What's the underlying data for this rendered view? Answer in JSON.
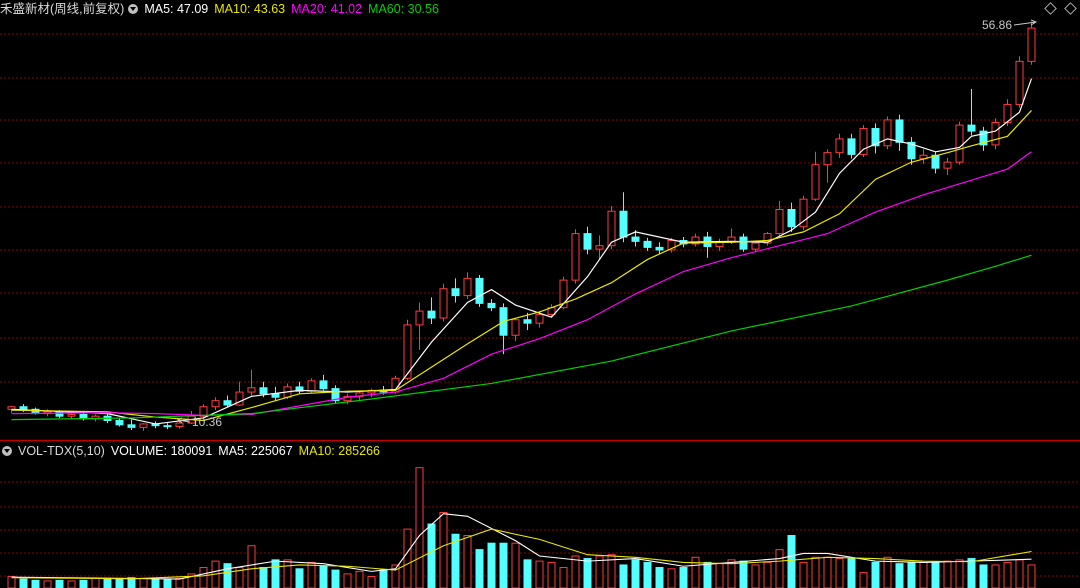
{
  "colors": {
    "up": "#ff3b3b",
    "down": "#54ffff",
    "ma5": "#ffffff",
    "ma10": "#e8e800",
    "ma20": "#ff00ff",
    "ma60": "#00d000",
    "grid": "#8a0000",
    "divider": "#c00000"
  },
  "header": {
    "stock_label": "禾盛新材(周线,前复权)",
    "ma5": "MA5: 47.09",
    "ma10": "MA10: 43.63",
    "ma20": "MA20: 41.02",
    "ma60": "MA60: 30.56"
  },
  "annotations": {
    "high": "56.86",
    "low": "10.36"
  },
  "volume_header": {
    "indicator": "VOL-TDX(5,10)",
    "volume": "VOLUME: 180091",
    "ma5": "MA5: 225067",
    "ma10": "MA10: 285266"
  },
  "chart_data": [
    {
      "type": "candlestick",
      "title": "禾盛新材(周线,前复权)",
      "y_range": [
        9.5,
        58.5
      ],
      "candles": [
        [
          12.6,
          13.0,
          12.2,
          12.9
        ],
        [
          12.9,
          13.2,
          12.3,
          12.6
        ],
        [
          12.6,
          12.8,
          12.0,
          12.1
        ],
        [
          12.1,
          12.6,
          11.8,
          12.3
        ],
        [
          12.3,
          12.5,
          11.6,
          11.8
        ],
        [
          11.8,
          12.3,
          11.5,
          12.0
        ],
        [
          12.0,
          12.4,
          11.3,
          11.5
        ],
        [
          11.5,
          12.0,
          11.2,
          11.8
        ],
        [
          11.8,
          12.1,
          11.0,
          11.3
        ],
        [
          11.3,
          11.6,
          10.6,
          10.8
        ],
        [
          10.8,
          11.4,
          10.2,
          10.5
        ],
        [
          10.5,
          11.0,
          10.1,
          10.9
        ],
        [
          10.9,
          11.2,
          10.4,
          10.7
        ],
        [
          10.7,
          11.0,
          10.3,
          10.6
        ],
        [
          10.6,
          11.3,
          10.36,
          11.0
        ],
        [
          11.0,
          12.4,
          10.9,
          11.8
        ],
        [
          11.8,
          13.2,
          11.6,
          12.9
        ],
        [
          12.9,
          14.0,
          12.5,
          13.6
        ],
        [
          13.6,
          14.2,
          12.9,
          13.1
        ],
        [
          13.1,
          15.8,
          13.0,
          14.6
        ],
        [
          14.6,
          17.2,
          14.2,
          15.1
        ],
        [
          15.1,
          15.8,
          14.0,
          14.4
        ],
        [
          14.4,
          15.2,
          13.6,
          14.0
        ],
        [
          14.0,
          15.6,
          13.8,
          15.2
        ],
        [
          15.2,
          15.8,
          14.4,
          14.7
        ],
        [
          14.7,
          16.2,
          14.5,
          15.9
        ],
        [
          15.9,
          16.6,
          14.8,
          15.0
        ],
        [
          15.0,
          15.4,
          13.3,
          13.6
        ],
        [
          13.6,
          14.4,
          13.2,
          14.1
        ],
        [
          14.1,
          14.8,
          13.7,
          14.5
        ],
        [
          14.5,
          15.0,
          14.0,
          14.8
        ],
        [
          14.8,
          15.3,
          14.3,
          14.6
        ],
        [
          14.6,
          16.5,
          14.4,
          16.2
        ],
        [
          16.2,
          23.0,
          16.0,
          22.4
        ],
        [
          22.4,
          25.0,
          19.5,
          24.0
        ],
        [
          24.0,
          25.6,
          22.5,
          23.2
        ],
        [
          23.2,
          27.2,
          22.8,
          26.6
        ],
        [
          26.6,
          27.8,
          25.0,
          25.8
        ],
        [
          25.8,
          28.5,
          25.4,
          27.8
        ],
        [
          27.8,
          28.2,
          24.5,
          24.9
        ],
        [
          24.9,
          25.4,
          24.0,
          24.4
        ],
        [
          24.4,
          24.9,
          19.0,
          21.2
        ],
        [
          21.2,
          23.2,
          20.5,
          23.0
        ],
        [
          23.0,
          23.8,
          21.8,
          22.6
        ],
        [
          22.6,
          24.0,
          22.1,
          23.6
        ],
        [
          23.6,
          24.8,
          23.4,
          24.4
        ],
        [
          24.4,
          28.0,
          24.2,
          27.6
        ],
        [
          27.6,
          33.5,
          27.2,
          33.0
        ],
        [
          33.0,
          33.8,
          30.6,
          31.2
        ],
        [
          31.2,
          32.8,
          30.0,
          31.6
        ],
        [
          31.6,
          36.2,
          31.2,
          35.6
        ],
        [
          35.6,
          37.8,
          32.0,
          32.6
        ],
        [
          32.6,
          33.4,
          31.5,
          32.1
        ],
        [
          32.1,
          32.5,
          31.0,
          31.4
        ],
        [
          31.4,
          32.0,
          30.6,
          31.1
        ],
        [
          31.1,
          32.5,
          30.8,
          32.2
        ],
        [
          32.2,
          32.6,
          31.4,
          31.8
        ],
        [
          31.8,
          33.0,
          31.5,
          32.6
        ],
        [
          32.6,
          33.2,
          30.2,
          31.5
        ],
        [
          31.5,
          32.4,
          31.0,
          32.0
        ],
        [
          32.0,
          33.6,
          31.8,
          32.6
        ],
        [
          32.6,
          33.0,
          30.9,
          31.2
        ],
        [
          31.2,
          32.2,
          30.9,
          31.9
        ],
        [
          31.9,
          33.2,
          31.6,
          33.0
        ],
        [
          33.0,
          36.8,
          32.7,
          35.8
        ],
        [
          35.8,
          36.6,
          33.2,
          33.8
        ],
        [
          33.8,
          37.4,
          33.4,
          37.0
        ],
        [
          37.0,
          42.5,
          36.8,
          41.0
        ],
        [
          41.0,
          42.8,
          38.9,
          42.4
        ],
        [
          42.4,
          44.6,
          41.8,
          44.0
        ],
        [
          44.0,
          44.6,
          41.7,
          42.2
        ],
        [
          42.2,
          45.6,
          41.9,
          45.2
        ],
        [
          45.2,
          45.8,
          42.3,
          43.2
        ],
        [
          43.2,
          46.6,
          42.8,
          46.2
        ],
        [
          46.2,
          46.8,
          42.6,
          43.6
        ],
        [
          43.6,
          44.2,
          41.0,
          41.7
        ],
        [
          41.7,
          42.8,
          41.1,
          42.1
        ],
        [
          42.1,
          42.5,
          40.0,
          40.6
        ],
        [
          40.6,
          41.8,
          39.8,
          41.3
        ],
        [
          41.3,
          46.0,
          41.0,
          45.6
        ],
        [
          45.6,
          49.8,
          44.4,
          44.9
        ],
        [
          44.9,
          45.4,
          42.6,
          43.3
        ],
        [
          43.3,
          46.4,
          42.8,
          45.9
        ],
        [
          45.9,
          48.6,
          45.5,
          48.0
        ],
        [
          48.0,
          53.6,
          47.6,
          53.0
        ],
        [
          53.0,
          57.6,
          52.6,
          56.86
        ]
      ],
      "moving_averages": {
        "MA5": [
          [
            0,
            12.6
          ],
          [
            8,
            12.1
          ],
          [
            12,
            10.9
          ],
          [
            16,
            11.6
          ],
          [
            20,
            14.1
          ],
          [
            24,
            14.8
          ],
          [
            28,
            14.6
          ],
          [
            32,
            14.9
          ],
          [
            35,
            20.4
          ],
          [
            38,
            25.0
          ],
          [
            40,
            26.5
          ],
          [
            42,
            24.7
          ],
          [
            45,
            23.3
          ],
          [
            48,
            28.0
          ],
          [
            50,
            32.0
          ],
          [
            52,
            33.2
          ],
          [
            56,
            32.0
          ],
          [
            60,
            32.1
          ],
          [
            63,
            32.0
          ],
          [
            65,
            33.4
          ],
          [
            67,
            35.5
          ],
          [
            69,
            40.0
          ],
          [
            71,
            42.8
          ],
          [
            73,
            44.0
          ],
          [
            75,
            43.4
          ],
          [
            77,
            42.5
          ],
          [
            79,
            43.0
          ],
          [
            80,
            44.3
          ],
          [
            82,
            44.9
          ],
          [
            84,
            47.1
          ],
          [
            85,
            51.0
          ]
        ],
        "MA10": [
          [
            0,
            12.5
          ],
          [
            8,
            12.3
          ],
          [
            12,
            11.7
          ],
          [
            16,
            11.3
          ],
          [
            20,
            12.8
          ],
          [
            24,
            14.4
          ],
          [
            28,
            14.7
          ],
          [
            32,
            14.8
          ],
          [
            35,
            17.5
          ],
          [
            38,
            20.2
          ],
          [
            41,
            22.8
          ],
          [
            44,
            23.9
          ],
          [
            47,
            25.4
          ],
          [
            50,
            27.3
          ],
          [
            53,
            30.0
          ],
          [
            56,
            31.9
          ],
          [
            60,
            32.0
          ],
          [
            63,
            32.2
          ],
          [
            66,
            33.2
          ],
          [
            69,
            35.3
          ],
          [
            72,
            39.3
          ],
          [
            75,
            41.3
          ],
          [
            78,
            42.4
          ],
          [
            80,
            43.2
          ],
          [
            83,
            44.3
          ],
          [
            85,
            47.3
          ]
        ],
        "MA20": [
          [
            0,
            12.1
          ],
          [
            8,
            12.2
          ],
          [
            12,
            12.1
          ],
          [
            16,
            11.9
          ],
          [
            20,
            12.0
          ],
          [
            24,
            13.0
          ],
          [
            28,
            14.0
          ],
          [
            32,
            14.6
          ],
          [
            36,
            16.2
          ],
          [
            40,
            19.0
          ],
          [
            44,
            20.8
          ],
          [
            48,
            23.0
          ],
          [
            52,
            26.0
          ],
          [
            56,
            28.6
          ],
          [
            60,
            30.2
          ],
          [
            64,
            31.6
          ],
          [
            68,
            33.0
          ],
          [
            72,
            35.5
          ],
          [
            76,
            37.5
          ],
          [
            80,
            39.2
          ],
          [
            83,
            40.5
          ],
          [
            85,
            42.5
          ]
        ],
        "MA60": [
          [
            0,
            11.4
          ],
          [
            10,
            11.6
          ],
          [
            20,
            12.1
          ],
          [
            30,
            13.8
          ],
          [
            40,
            15.6
          ],
          [
            50,
            18.2
          ],
          [
            60,
            21.7
          ],
          [
            70,
            24.6
          ],
          [
            78,
            27.6
          ],
          [
            82,
            29.2
          ],
          [
            85,
            30.5
          ]
        ]
      }
    },
    {
      "type": "bar",
      "title": "VOL-TDX(5,10)",
      "y_range": [
        0,
        1000000
      ],
      "volumes": [
        90000,
        70000,
        60000,
        55000,
        60000,
        55000,
        60000,
        75000,
        75000,
        75000,
        80000,
        75000,
        70000,
        65000,
        75000,
        110000,
        160000,
        210000,
        190000,
        160000,
        330000,
        160000,
        220000,
        220000,
        150000,
        200000,
        170000,
        140000,
        110000,
        130000,
        90000,
        140000,
        180000,
        460000,
        940000,
        500000,
        590000,
        420000,
        410000,
        300000,
        350000,
        350000,
        350000,
        220000,
        210000,
        200000,
        160000,
        250000,
        230000,
        250000,
        260000,
        180000,
        220000,
        200000,
        160000,
        150000,
        160000,
        240000,
        200000,
        190000,
        220000,
        210000,
        180000,
        200000,
        300000,
        410000,
        200000,
        240000,
        240000,
        230000,
        230000,
        120000,
        200000,
        240000,
        190000,
        200000,
        200000,
        200000,
        210000,
        220000,
        230000,
        180000,
        180000,
        200000,
        220000,
        180091
      ],
      "MA5": [
        [
          0,
          85000
        ],
        [
          10,
          75000
        ],
        [
          14,
          70000
        ],
        [
          18,
          150000
        ],
        [
          22,
          210000
        ],
        [
          26,
          190000
        ],
        [
          30,
          130000
        ],
        [
          32,
          150000
        ],
        [
          34,
          410000
        ],
        [
          36,
          580000
        ],
        [
          38,
          560000
        ],
        [
          42,
          370000
        ],
        [
          44,
          250000
        ],
        [
          48,
          210000
        ],
        [
          52,
          230000
        ],
        [
          56,
          170000
        ],
        [
          60,
          200000
        ],
        [
          64,
          230000
        ],
        [
          66,
          270000
        ],
        [
          68,
          270000
        ],
        [
          72,
          210000
        ],
        [
          76,
          200000
        ],
        [
          80,
          210000
        ],
        [
          85,
          225067
        ]
      ],
      "MA10": [
        [
          0,
          80000
        ],
        [
          10,
          72000
        ],
        [
          16,
          95000
        ],
        [
          20,
          150000
        ],
        [
          24,
          180000
        ],
        [
          28,
          170000
        ],
        [
          32,
          140000
        ],
        [
          36,
          330000
        ],
        [
          40,
          460000
        ],
        [
          44,
          380000
        ],
        [
          48,
          260000
        ],
        [
          52,
          240000
        ],
        [
          56,
          200000
        ],
        [
          60,
          190000
        ],
        [
          64,
          210000
        ],
        [
          68,
          240000
        ],
        [
          72,
          230000
        ],
        [
          76,
          210000
        ],
        [
          80,
          205000
        ],
        [
          85,
          285266
        ]
      ]
    }
  ]
}
